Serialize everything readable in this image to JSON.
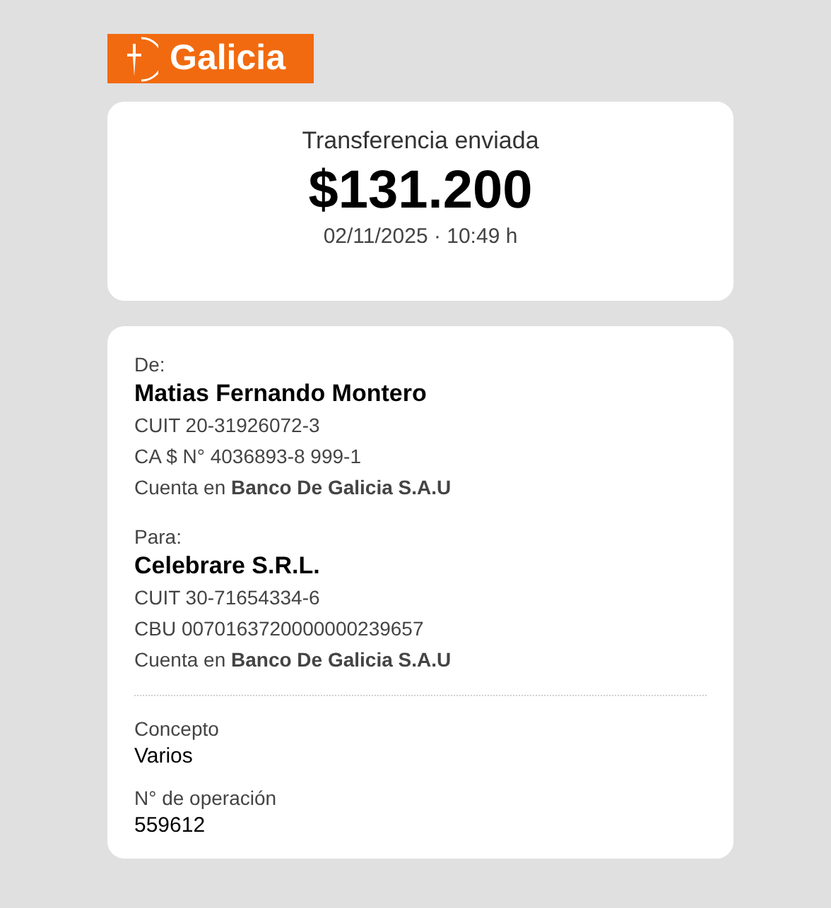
{
  "logo": {
    "text": "Galicia"
  },
  "summary": {
    "title": "Transferencia enviada",
    "amount": "$131.200",
    "datetime": "02/11/2025 · 10:49 h"
  },
  "parties": [
    {
      "label": "De:",
      "name": "Matias Fernando Montero",
      "lines": [
        "CUIT 20-31926072-3",
        "CA $ N° 4036893-8 999-1",
        "Cuenta en **Banco De Galicia S.A.U**"
      ]
    },
    {
      "label": "Para:",
      "name": "Celebrare S.R.L.",
      "lines": [
        "CUIT 30-71654334-6",
        "CBU 0070163720000000239657",
        "Cuenta en **Banco De Galicia S.A.U**"
      ]
    }
  ],
  "details": [
    {
      "label": "Concepto",
      "value": "Varios"
    },
    {
      "label": "N° de operación",
      "value": "559612"
    }
  ]
}
